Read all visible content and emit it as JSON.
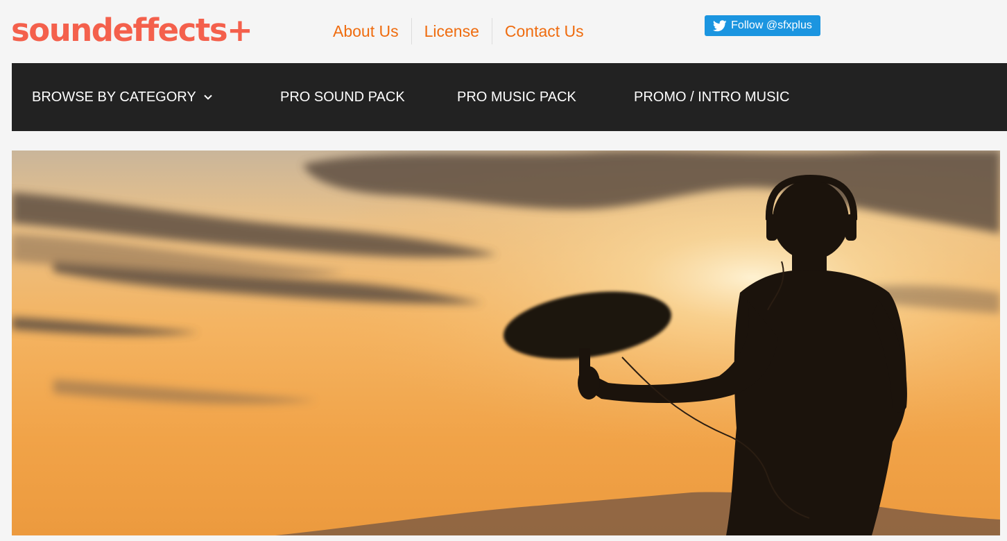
{
  "header": {
    "logo_text": "soundeffects+",
    "links": [
      {
        "label": "About Us"
      },
      {
        "label": "License"
      },
      {
        "label": "Contact Us"
      }
    ],
    "follow_label": "Follow @sfxplus",
    "follow_icon": "twitter-bird-icon"
  },
  "nav": {
    "items": [
      {
        "label": "BROWSE BY CATEGORY",
        "icon": "chevron-down-icon"
      },
      {
        "label": "PRO SOUND PACK"
      },
      {
        "label": "PRO MUSIC PACK"
      },
      {
        "label": "PROMO / INTRO MUSIC"
      }
    ]
  },
  "colors": {
    "brand": "#f4604c",
    "link": "#ef6c0f",
    "nav_bg": "#222222",
    "twitter": "#1b95e0"
  },
  "hero": {
    "image": "silhouette-sound-recordist-sunset"
  }
}
